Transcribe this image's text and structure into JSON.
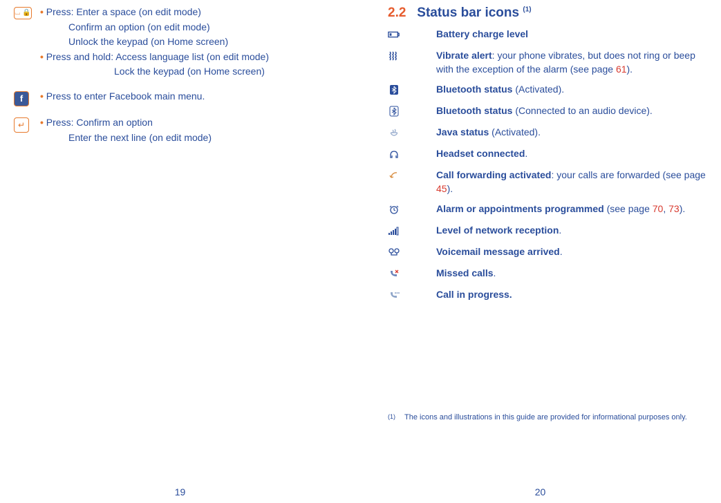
{
  "left": {
    "block1": {
      "label": "Press:",
      "l1": "Enter a space (on edit mode)",
      "l2": "Confirm an option (on edit mode)",
      "l3": "Unlock the keypad (on Home screen)",
      "label2": "Press and hold:",
      "l4": "Access language list (on edit mode)",
      "l5": "Lock the keypad (on Home screen)"
    },
    "block2": {
      "text": "Press to enter Facebook main menu."
    },
    "block3": {
      "label": "Press:",
      "l1": "Confirm an option",
      "l2": "Enter the next line (on edit mode)"
    },
    "pageNum": "19"
  },
  "right": {
    "sectionNum": "2.2",
    "sectionTitle": "Status bar icons",
    "sectionSup": "(1)",
    "items": [
      {
        "bold": "Battery charge level",
        "rest": ""
      },
      {
        "bold": "Vibrate alert",
        "rest": ": your phone vibrates, but does not ring or beep with the exception of the alarm (see page ",
        "ref": "61",
        "after": ")."
      },
      {
        "bold": "Bluetooth status",
        "rest": " (Activated)."
      },
      {
        "bold": "Bluetooth status",
        "rest": " (Connected to an audio device)."
      },
      {
        "bold": "Java status",
        "rest": " (Activated)."
      },
      {
        "bold": "Headset connected",
        "rest": "."
      },
      {
        "bold": "Call forwarding activated",
        "rest": ": your calls are forwarded (see page ",
        "ref": "45",
        "after": ")."
      },
      {
        "bold": "Alarm or appointments programmed",
        "rest": " (see page ",
        "ref": "70",
        "ref2": "73",
        "after": ")."
      },
      {
        "bold": "Level of network reception",
        "rest": "."
      },
      {
        "bold": "Voicemail message arrived",
        "rest": "."
      },
      {
        "bold": "Missed calls",
        "rest": "."
      },
      {
        "bold": "Call in progress.",
        "rest": ""
      }
    ],
    "footnoteSup": "(1)",
    "footnote": "The icons and illustrations in this guide are provided for informational purposes only.",
    "pageNum": "20"
  },
  "iconNames": [
    "space-key-icon",
    "facebook-key-icon",
    "enter-key-icon",
    "battery-icon",
    "vibrate-icon",
    "bluetooth-icon",
    "bluetooth-audio-icon",
    "java-icon",
    "headset-icon",
    "call-forward-icon",
    "alarm-icon",
    "signal-icon",
    "voicemail-icon",
    "missed-call-icon",
    "call-progress-icon"
  ]
}
